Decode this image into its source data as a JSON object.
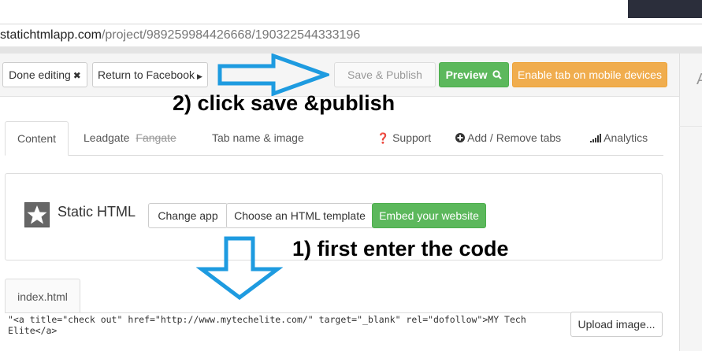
{
  "browser": {
    "url_host": "statichtmlapp.com",
    "url_path": "/project/989259984426668/190322544333196"
  },
  "toolbar": {
    "done_label": "Done editing",
    "done_icon": "times-icon",
    "return_label": "Return to Facebook",
    "return_icon": "caret-right-icon",
    "save_label": "Save & Publish",
    "preview_label": "Preview",
    "preview_icon": "search-icon",
    "mobile_label": "Enable tab on mobile devices"
  },
  "annotations": {
    "step2": "2) click save &publish",
    "step1": "1) first enter the code"
  },
  "tabs": {
    "content": "Content",
    "leadgate": "Leadgate",
    "fangate": "Fangate",
    "tab_name": "Tab name & image",
    "support": "Support",
    "add_remove": "Add / Remove tabs",
    "analytics": "Analytics"
  },
  "app_panel": {
    "title": "Static HTML",
    "change_app": "Change app",
    "choose_template": "Choose an HTML template",
    "embed": "Embed your website"
  },
  "editor": {
    "file_tab": "index.html",
    "code": "\"<a title=\"check out\" href=\"http://www.mytechelite.com/\" target=\"_blank\" rel=\"dofollow\">MY Tech\nElite</a>",
    "upload_label": "Upload image..."
  },
  "colors": {
    "green": "#5cb85c",
    "orange": "#f0ad4e",
    "arrow_blue": "#1e9be0"
  }
}
